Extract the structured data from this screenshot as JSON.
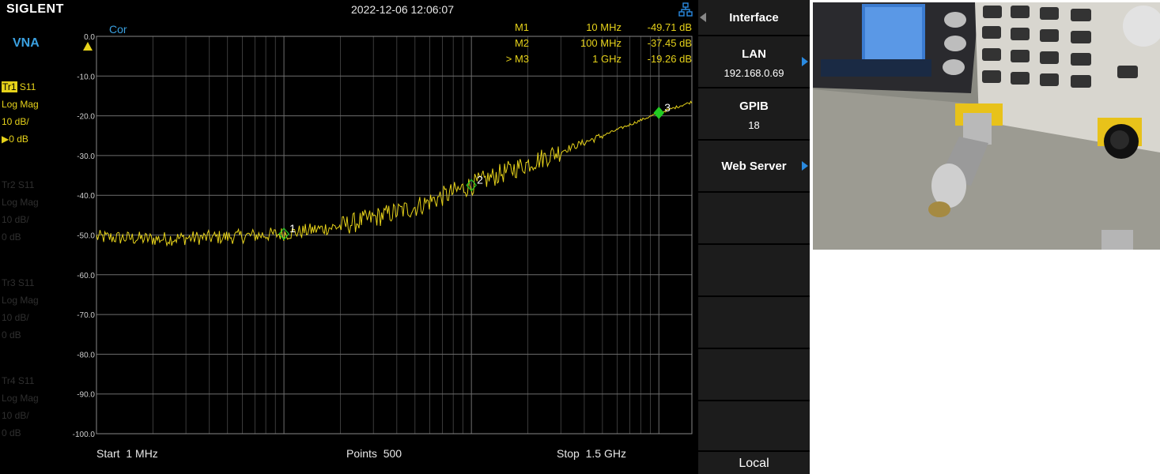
{
  "header": {
    "brand": "SIGLENT",
    "datetime": "2022-12-06 12:06:07"
  },
  "mode": "VNA",
  "traces": [
    {
      "id": "Tr1",
      "param": "S11",
      "format": "Log Mag",
      "scale": "10 dB/",
      "ref": "0 dB",
      "active": true
    },
    {
      "id": "Tr2",
      "param": "S11",
      "format": "Log Mag",
      "scale": "10 dB/",
      "ref": "0 dB",
      "active": false
    },
    {
      "id": "Tr3",
      "param": "S11",
      "format": "Log Mag",
      "scale": "10 dB/",
      "ref": "0 dB",
      "active": false
    },
    {
      "id": "Tr4",
      "param": "S11",
      "format": "Log Mag",
      "scale": "10 dB/",
      "ref": "0 dB",
      "active": false
    }
  ],
  "correction": "Cor",
  "markers_table": [
    {
      "name": "M1",
      "freq": "10 MHz",
      "value": "-49.71 dB"
    },
    {
      "name": "M2",
      "freq": "100 MHz",
      "value": "-37.45 dB"
    },
    {
      "name": "> M3",
      "freq": "1 GHz",
      "value": "-19.26 dB"
    }
  ],
  "sweep": {
    "start_label": "Start",
    "start": "1 MHz",
    "points_label": "Points",
    "points": "500",
    "stop_label": "Stop",
    "stop": "1.5 GHz"
  },
  "softkeys": {
    "interface": "Interface",
    "lan": {
      "title": "LAN",
      "value": "192.168.0.69"
    },
    "gpib": {
      "title": "GPIB",
      "value": "18"
    },
    "web_server": "Web Server",
    "local": "Local"
  },
  "chart_data": {
    "type": "line",
    "x_scale": "log",
    "x_range_mhz": [
      1,
      1500
    ],
    "y_range_db": [
      -100,
      0
    ],
    "y_ticks": [
      "0.0",
      "-10.0",
      "-20.0",
      "-30.0",
      "-40.0",
      "-50.0",
      "-60.0",
      "-70.0",
      "-80.0",
      "-90.0",
      "-100.0"
    ],
    "grid": true,
    "trace_color": "#e6d21a",
    "marker_color": "#22cc22",
    "x_mhz": [
      1,
      2,
      5,
      10,
      20,
      50,
      100,
      200,
      500,
      1000,
      1500
    ],
    "y_db": [
      -50.5,
      -51.0,
      -50.5,
      -49.7,
      -47.8,
      -43.0,
      -37.45,
      -32.0,
      -25.0,
      -19.26,
      -16.5
    ],
    "markers": [
      {
        "label": "1",
        "x_mhz": 10,
        "y_db": -49.71,
        "filled": false
      },
      {
        "label": "2",
        "x_mhz": 100,
        "y_db": -37.45,
        "filled": false
      },
      {
        "label": "3",
        "x_mhz": 1000,
        "y_db": -19.26,
        "filled": true
      }
    ]
  }
}
